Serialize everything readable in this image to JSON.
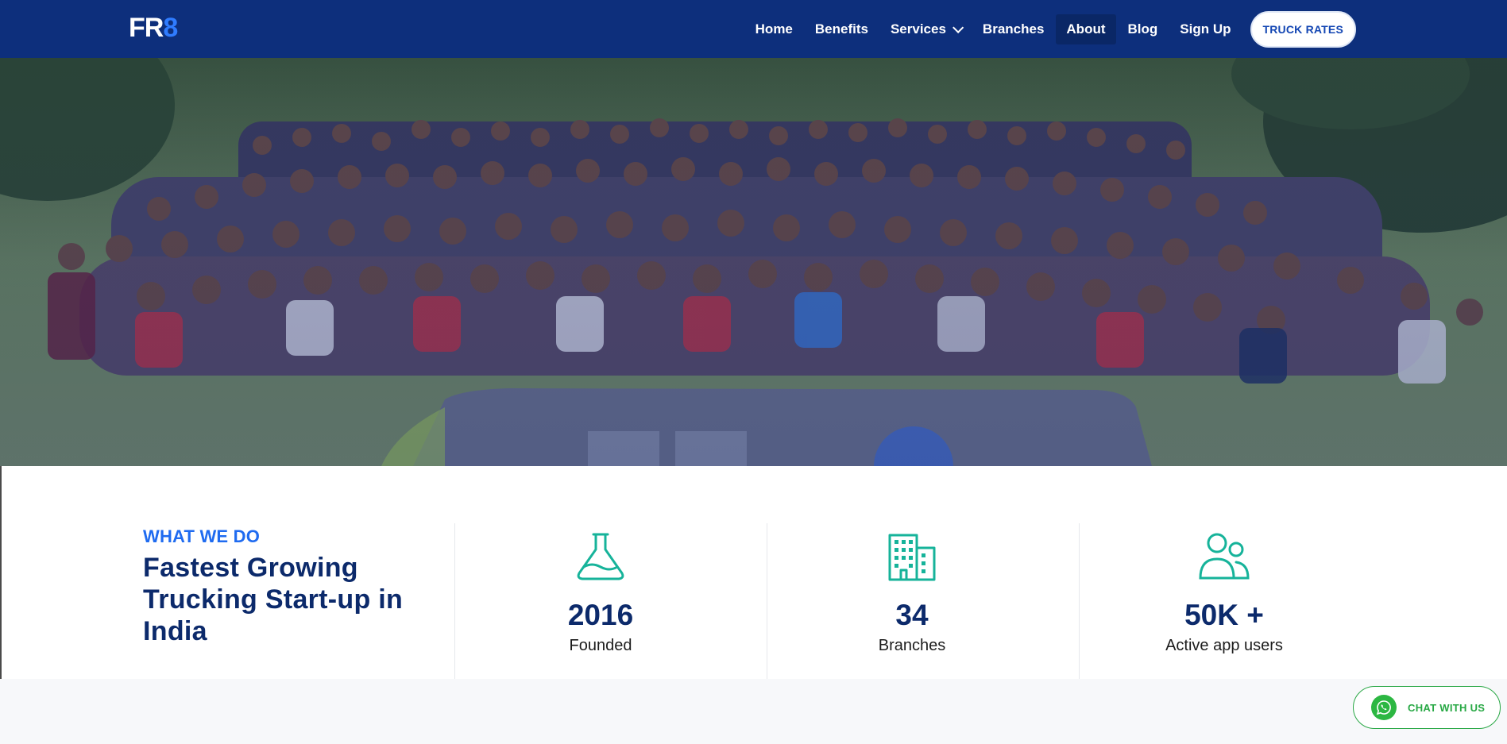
{
  "brand": {
    "logo_main": "FR",
    "logo_accent": "8"
  },
  "nav": {
    "items": [
      "Home",
      "Benefits",
      "Services",
      "Branches",
      "About",
      "Blog",
      "Sign Up"
    ],
    "active": "About",
    "cta": "TRUCK RATES"
  },
  "colors": {
    "navbar_bg": "#0d2f7c",
    "accent_blue": "#1f6bf0",
    "heading_navy": "#0c2a6b",
    "icon_teal": "#16b39a",
    "whatsapp_green": "#27a844"
  },
  "hero": {
    "image": "team-group-photo"
  },
  "stats_section": {
    "kicker": "WHAT WE DO",
    "headline": "Fastest Growing Trucking Start-up in India",
    "stats": [
      {
        "icon": "flask-icon",
        "value": "2016",
        "label": "Founded"
      },
      {
        "icon": "buildings-icon",
        "value": "34",
        "label": "Branches"
      },
      {
        "icon": "users-icon",
        "value": "50K +",
        "label": "Active app users"
      }
    ]
  },
  "chat": {
    "label": "CHAT WITH US",
    "icon": "whatsapp-icon"
  }
}
